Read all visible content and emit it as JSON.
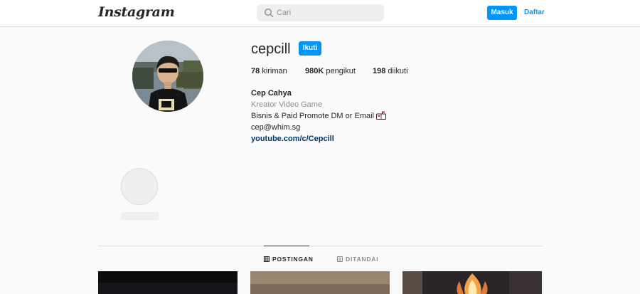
{
  "header": {
    "logo_text": "Instagram",
    "search_placeholder": "Cari",
    "login_label": "Masuk",
    "signup_label": "Daftar"
  },
  "profile": {
    "username": "cepcill",
    "follow_label": "Ikuti",
    "stats": {
      "posts_count": "78",
      "posts_label": "kiriman",
      "followers_count": "980K",
      "followers_label": "pengikut",
      "following_count": "198",
      "following_label": "diikuti"
    },
    "bio": {
      "name": "Cep Cahya",
      "category": "Kreator Video Game",
      "line1": "Bisnis & Paid Promote DM or Email",
      "line2": "cep@whim.sg",
      "link": "youtube.com/c/Cepcill"
    }
  },
  "tabs": [
    {
      "label": "POSTINGAN",
      "icon": "grid-icon",
      "active": true
    },
    {
      "label": "DITANDAI",
      "icon": "tag-user-icon",
      "active": false
    }
  ],
  "colors": {
    "accent": "#0095f6",
    "link": "#00376b",
    "muted": "#8e8e8e",
    "border": "#dbdbdb",
    "background": "#fafafa"
  }
}
